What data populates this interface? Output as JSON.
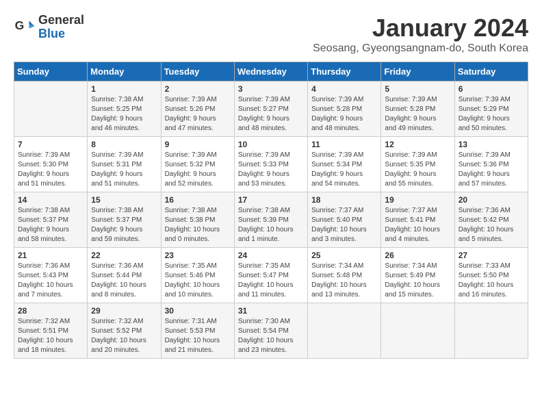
{
  "logo": {
    "general": "General",
    "blue": "Blue"
  },
  "title": "January 2024",
  "location": "Seosang, Gyeongsangnam-do, South Korea",
  "headers": [
    "Sunday",
    "Monday",
    "Tuesday",
    "Wednesday",
    "Thursday",
    "Friday",
    "Saturday"
  ],
  "weeks": [
    [
      {
        "day": "",
        "info": ""
      },
      {
        "day": "1",
        "info": "Sunrise: 7:38 AM\nSunset: 5:25 PM\nDaylight: 9 hours\nand 46 minutes."
      },
      {
        "day": "2",
        "info": "Sunrise: 7:39 AM\nSunset: 5:26 PM\nDaylight: 9 hours\nand 47 minutes."
      },
      {
        "day": "3",
        "info": "Sunrise: 7:39 AM\nSunset: 5:27 PM\nDaylight: 9 hours\nand 48 minutes."
      },
      {
        "day": "4",
        "info": "Sunrise: 7:39 AM\nSunset: 5:28 PM\nDaylight: 9 hours\nand 48 minutes."
      },
      {
        "day": "5",
        "info": "Sunrise: 7:39 AM\nSunset: 5:28 PM\nDaylight: 9 hours\nand 49 minutes."
      },
      {
        "day": "6",
        "info": "Sunrise: 7:39 AM\nSunset: 5:29 PM\nDaylight: 9 hours\nand 50 minutes."
      }
    ],
    [
      {
        "day": "7",
        "info": "Sunrise: 7:39 AM\nSunset: 5:30 PM\nDaylight: 9 hours\nand 51 minutes."
      },
      {
        "day": "8",
        "info": "Sunrise: 7:39 AM\nSunset: 5:31 PM\nDaylight: 9 hours\nand 51 minutes."
      },
      {
        "day": "9",
        "info": "Sunrise: 7:39 AM\nSunset: 5:32 PM\nDaylight: 9 hours\nand 52 minutes."
      },
      {
        "day": "10",
        "info": "Sunrise: 7:39 AM\nSunset: 5:33 PM\nDaylight: 9 hours\nand 53 minutes."
      },
      {
        "day": "11",
        "info": "Sunrise: 7:39 AM\nSunset: 5:34 PM\nDaylight: 9 hours\nand 54 minutes."
      },
      {
        "day": "12",
        "info": "Sunrise: 7:39 AM\nSunset: 5:35 PM\nDaylight: 9 hours\nand 55 minutes."
      },
      {
        "day": "13",
        "info": "Sunrise: 7:39 AM\nSunset: 5:36 PM\nDaylight: 9 hours\nand 57 minutes."
      }
    ],
    [
      {
        "day": "14",
        "info": "Sunrise: 7:38 AM\nSunset: 5:37 PM\nDaylight: 9 hours\nand 58 minutes."
      },
      {
        "day": "15",
        "info": "Sunrise: 7:38 AM\nSunset: 5:37 PM\nDaylight: 9 hours\nand 59 minutes."
      },
      {
        "day": "16",
        "info": "Sunrise: 7:38 AM\nSunset: 5:38 PM\nDaylight: 10 hours\nand 0 minutes."
      },
      {
        "day": "17",
        "info": "Sunrise: 7:38 AM\nSunset: 5:39 PM\nDaylight: 10 hours\nand 1 minute."
      },
      {
        "day": "18",
        "info": "Sunrise: 7:37 AM\nSunset: 5:40 PM\nDaylight: 10 hours\nand 3 minutes."
      },
      {
        "day": "19",
        "info": "Sunrise: 7:37 AM\nSunset: 5:41 PM\nDaylight: 10 hours\nand 4 minutes."
      },
      {
        "day": "20",
        "info": "Sunrise: 7:36 AM\nSunset: 5:42 PM\nDaylight: 10 hours\nand 5 minutes."
      }
    ],
    [
      {
        "day": "21",
        "info": "Sunrise: 7:36 AM\nSunset: 5:43 PM\nDaylight: 10 hours\nand 7 minutes."
      },
      {
        "day": "22",
        "info": "Sunrise: 7:36 AM\nSunset: 5:44 PM\nDaylight: 10 hours\nand 8 minutes."
      },
      {
        "day": "23",
        "info": "Sunrise: 7:35 AM\nSunset: 5:46 PM\nDaylight: 10 hours\nand 10 minutes."
      },
      {
        "day": "24",
        "info": "Sunrise: 7:35 AM\nSunset: 5:47 PM\nDaylight: 10 hours\nand 11 minutes."
      },
      {
        "day": "25",
        "info": "Sunrise: 7:34 AM\nSunset: 5:48 PM\nDaylight: 10 hours\nand 13 minutes."
      },
      {
        "day": "26",
        "info": "Sunrise: 7:34 AM\nSunset: 5:49 PM\nDaylight: 10 hours\nand 15 minutes."
      },
      {
        "day": "27",
        "info": "Sunrise: 7:33 AM\nSunset: 5:50 PM\nDaylight: 10 hours\nand 16 minutes."
      }
    ],
    [
      {
        "day": "28",
        "info": "Sunrise: 7:32 AM\nSunset: 5:51 PM\nDaylight: 10 hours\nand 18 minutes."
      },
      {
        "day": "29",
        "info": "Sunrise: 7:32 AM\nSunset: 5:52 PM\nDaylight: 10 hours\nand 20 minutes."
      },
      {
        "day": "30",
        "info": "Sunrise: 7:31 AM\nSunset: 5:53 PM\nDaylight: 10 hours\nand 21 minutes."
      },
      {
        "day": "31",
        "info": "Sunrise: 7:30 AM\nSunset: 5:54 PM\nDaylight: 10 hours\nand 23 minutes."
      },
      {
        "day": "",
        "info": ""
      },
      {
        "day": "",
        "info": ""
      },
      {
        "day": "",
        "info": ""
      }
    ]
  ]
}
